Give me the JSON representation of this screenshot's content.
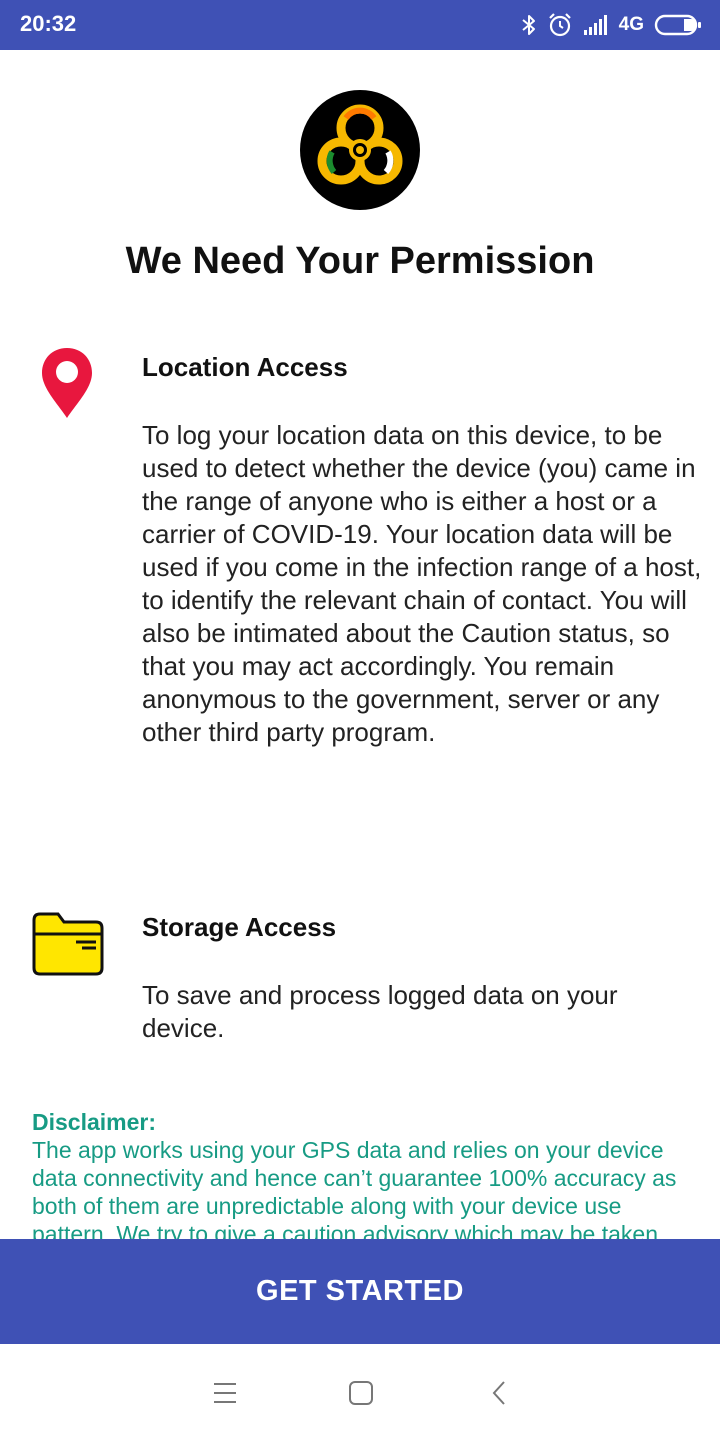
{
  "status_bar": {
    "time": "20:32",
    "network_label": "4G",
    "icons": [
      "bluetooth-icon",
      "alarm-icon",
      "signal-icon",
      "battery-icon"
    ]
  },
  "colors": {
    "primary": "#3f51b5",
    "disclaimer_text": "#179b84",
    "location_pin": "#e8173e",
    "folder": "#ffe600"
  },
  "header": {
    "logo_icon": "biohazard-logo-icon",
    "title": "We Need Your Permission"
  },
  "permissions": [
    {
      "icon": "location-pin-icon",
      "title": "Location Access",
      "description": "To log your location data on this device, to be used to detect whether the device (you) came in the range of anyone who is either a host or a carrier of COVID-19. Your location data will be used if you come in the infection range of a host, to identify the relevant chain of contact. You will also be intimated about the Caution status, so that you may act accordingly. You remain anonymous to the government, server or any other third party program."
    },
    {
      "icon": "folder-icon",
      "title": "Storage Access",
      "description": "To save and process logged data on your device."
    }
  ],
  "disclaimer": {
    "title": "Disclaimer:",
    "text": "The app works using your GPS data and relies on your device data connectivity and hence can’t guarantee 100% accuracy as both of them are unpredictable along with your device use pattern. We try to give a caution advisory which may be taken"
  },
  "cta": {
    "label": "GET STARTED"
  },
  "nav_bar": {
    "icons": [
      "menu-icon",
      "home-icon",
      "back-icon"
    ]
  }
}
